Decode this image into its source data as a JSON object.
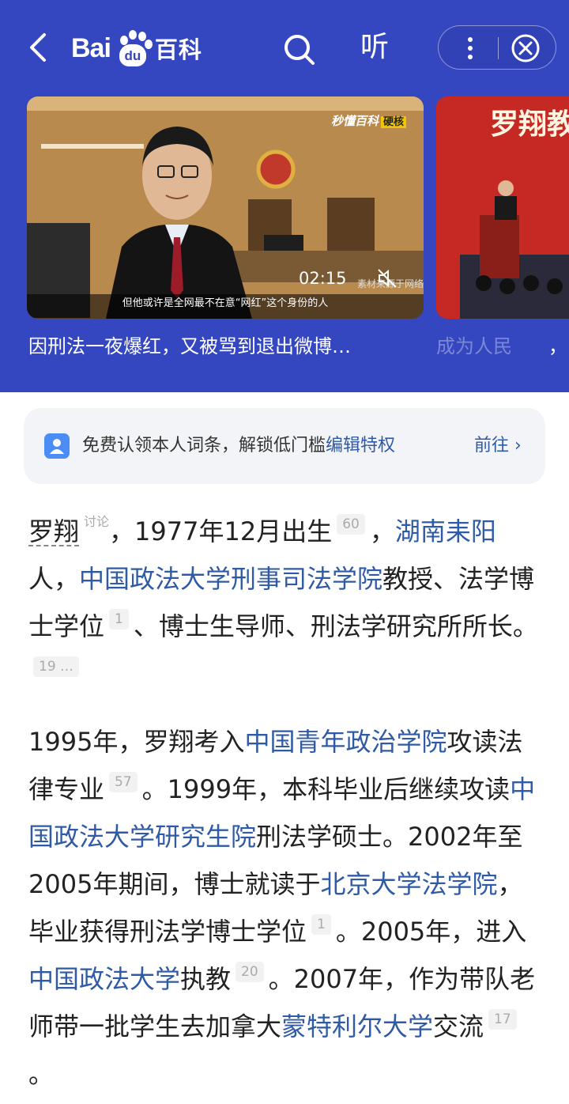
{
  "header": {
    "logo_text_left": "Bai",
    "logo_paw_text": "du",
    "logo_text_right": "百科",
    "listen_label": "听"
  },
  "video": {
    "badge": "秒懂百科",
    "badge_tag": "硬核",
    "duration": "02:15",
    "watermark": "素材来源于网络",
    "subtitle": "但他或许是全网最不在意“网红”这个身份的人",
    "caption": "因刑法一夜爆红，又被骂到退出微博…",
    "second_title": "罗翔教",
    "second_caption": "成为人民",
    "second_caption_end": "，"
  },
  "claim": {
    "text": "免费认领本人词条，解锁低门槛",
    "highlight": "编辑特权",
    "goto": "前往 ›"
  },
  "article": {
    "p1": {
      "name": "罗翔",
      "tag": "讨论",
      "t1": "，1977年12月出生",
      "r1": "60",
      "t2": "，",
      "l1": "湖南耒阳",
      "t3": "人，",
      "l2": "中国政法大学刑事司法学院",
      "t4": "教授、法学博士学位",
      "r2": "1",
      "t5": "、博士生导师、刑法学研究所所长。",
      "r3": "19 …"
    },
    "p2": {
      "t1": "1995年，罗翔考入",
      "l1": "中国青年政治学院",
      "t2": "攻读法律专业",
      "r1": "57",
      "t3": "。1999年，本科毕业后继续攻读",
      "l2": "中国政法大学研究生院",
      "t4": "刑法学硕士。2002年至2005年期间，博士就读于",
      "l3": "北京大学法学院",
      "t5": "，毕业获得刑法学博士学位",
      "r2": "1",
      "t6": "。2005年，进入",
      "l4": "中国政法大学",
      "t7": "执教",
      "r3": "20",
      "t8": "。2007年，作为带队老师带一批学生去加拿大",
      "l5": "蒙特利尔大学",
      "t9": "交流",
      "r4": "17",
      "t10": "。"
    }
  },
  "colors": {
    "header_bg": "#3447c1",
    "link": "#2f5aa6"
  }
}
